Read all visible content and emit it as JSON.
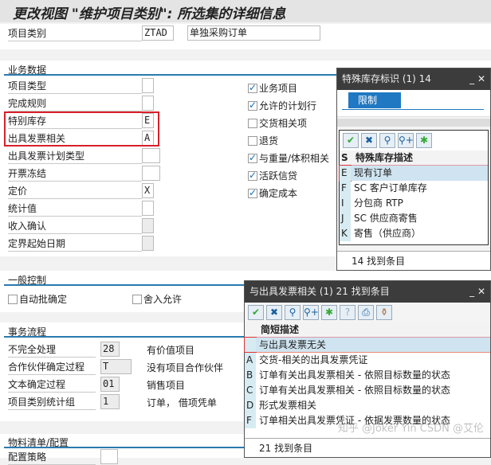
{
  "title": "更改视图 \"维护项目类别\": 所选集的详细信息",
  "header": {
    "label": "项目类别",
    "code": "ZTAD",
    "desc": "单独采购订单"
  },
  "business": {
    "title": "业务数据",
    "fields": [
      {
        "label": "项目类型",
        "value": ""
      },
      {
        "label": "完成规则",
        "value": ""
      },
      {
        "label": "特别库存",
        "value": "E"
      },
      {
        "label": "出具发票相关",
        "value": "A"
      },
      {
        "label": "出具发票计划类型",
        "value": ""
      },
      {
        "label": "开票冻结",
        "value": ""
      },
      {
        "label": "定价",
        "value": "X"
      },
      {
        "label": "统计值",
        "value": ""
      },
      {
        "label": "收入确认",
        "value": ""
      },
      {
        "label": "定界起始日期",
        "value": ""
      }
    ],
    "checks": [
      {
        "label": "业务项目",
        "checked": true
      },
      {
        "label": "允许的计划行",
        "checked": true
      },
      {
        "label": "交货相关项",
        "checked": false
      },
      {
        "label": "退货",
        "checked": false
      },
      {
        "label": "与重量/体积相关",
        "checked": true
      },
      {
        "label": "活跃信贷",
        "checked": true
      },
      {
        "label": "确定成本",
        "checked": true
      }
    ]
  },
  "general": {
    "title": "一般控制",
    "checks": [
      {
        "label": "自动批确定",
        "checked": false
      },
      {
        "label": "舍入允许",
        "checked": false
      }
    ]
  },
  "flow": {
    "title": "事务流程",
    "rows": [
      {
        "label": "不完全处理",
        "value": "28",
        "desc": "有价值项目"
      },
      {
        "label": "合作伙伴确定过程",
        "value": "T",
        "desc": "没有项目合作伙伴"
      },
      {
        "label": "文本确定过程",
        "value": "01",
        "desc": "销售项目"
      },
      {
        "label": "项目类别统计组",
        "value": "1",
        "desc": "订单， 借项凭单"
      }
    ]
  },
  "bom": {
    "title": "物料清单/配置",
    "row": {
      "label": "配置策略",
      "value": ""
    }
  },
  "popup1": {
    "title": "特殊库存标识 (1)  14",
    "tab": "限制",
    "col_key": "S",
    "col_desc": "特殊库存描述",
    "rows": [
      {
        "k": "E",
        "v": "现有订单"
      },
      {
        "k": "F",
        "v": "SC 客户订单库存"
      },
      {
        "k": "I",
        "v": "分包商 RTP"
      },
      {
        "k": "J",
        "v": "SC 供应商寄售"
      },
      {
        "k": "K",
        "v": "寄售（供应商）"
      }
    ],
    "footer": "14 找到条目"
  },
  "popup2": {
    "title": "与出具发票相关 (1)  21 找到条目",
    "col_desc": "简短描述",
    "rows": [
      {
        "k": "",
        "v": "与出具发票无关"
      },
      {
        "k": "A",
        "v": "交货-相关的出具发票凭证"
      },
      {
        "k": "B",
        "v": "订单有关出具发票相关 - 依照目标数量的状态"
      },
      {
        "k": "C",
        "v": "订单有关出具发票相关 - 依照目标数量的状态"
      },
      {
        "k": "D",
        "v": "形式发票相关"
      },
      {
        "k": "F",
        "v": "订单相关出具发票凭证 - 依据发票数量的状态"
      }
    ],
    "footer": "21 找到条目"
  },
  "watermark": "知乎 @Joker Yin  CSDN @艾伦"
}
